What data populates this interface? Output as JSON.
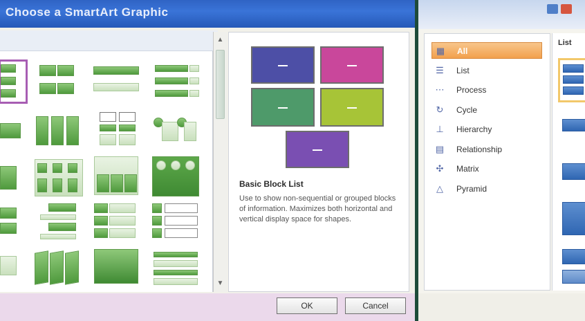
{
  "window": {
    "title": "Choose a SmartArt Graphic"
  },
  "gallery": {
    "scroll_up_glyph": "▲",
    "scroll_down_glyph": "▼"
  },
  "preview": {
    "title": "Basic Block List",
    "description": "Use to show non-sequential or grouped blocks of information. Maximizes both horizontal and vertical display space for shapes.",
    "block_colors": [
      "#4d4fa6",
      "#c9479b",
      "#4e9a6a",
      "#a7c437",
      "#7a4fb2"
    ]
  },
  "buttons": {
    "ok_label": "OK",
    "cancel_label": "Cancel"
  },
  "categories": {
    "items": [
      {
        "label": "All",
        "icon": "grid-icon",
        "glyph": "▦",
        "selected": true
      },
      {
        "label": "List",
        "icon": "list-icon",
        "glyph": "☰",
        "selected": false
      },
      {
        "label": "Process",
        "icon": "process-icon",
        "glyph": "⋯",
        "selected": false
      },
      {
        "label": "Cycle",
        "icon": "cycle-icon",
        "glyph": "↻",
        "selected": false
      },
      {
        "label": "Hierarchy",
        "icon": "hierarchy-icon",
        "glyph": "⊥",
        "selected": false
      },
      {
        "label": "Relationship",
        "icon": "relationship-icon",
        "glyph": "▤",
        "selected": false
      },
      {
        "label": "Matrix",
        "icon": "matrix-icon",
        "glyph": "✣",
        "selected": false
      },
      {
        "label": "Pyramid",
        "icon": "pyramid-icon",
        "glyph": "△",
        "selected": false
      }
    ]
  },
  "right_preview": {
    "header": "List"
  },
  "colors": {
    "title_bar": "#2f63c4",
    "accent_selected": "#f2a04d",
    "graphic_green": "#4f9a3d",
    "graphic_blue": "#2f66b2",
    "selection_border": "#a75db3"
  }
}
